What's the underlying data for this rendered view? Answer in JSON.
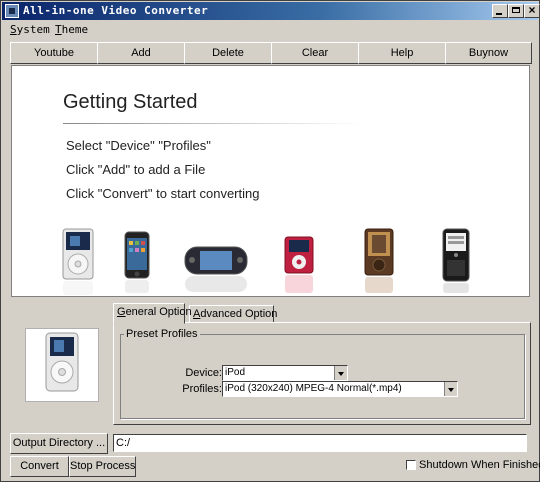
{
  "window": {
    "title": "All-in-one Video Converter"
  },
  "menu": [
    "System",
    "Theme"
  ],
  "toolbar": [
    "Youtube",
    "Add",
    "Delete",
    "Clear",
    "Help",
    "Buynow"
  ],
  "getting_started": {
    "title": "Getting Started",
    "lines": [
      "Select \"Device\" \"Profiles\"",
      "Click  \"Add\" to add a File",
      "Click  \"Convert\" to start converting"
    ]
  },
  "devices": [
    "ipod-classic",
    "iphone",
    "psp",
    "ipod-nano",
    "zune",
    "blackberry"
  ],
  "tabs": {
    "general": "General Option",
    "advanced": "Advanced Option"
  },
  "preset": {
    "group_label": "Preset Profiles",
    "device_label": "Device:",
    "device_value": "iPod",
    "profiles_label": "Profiles:",
    "profiles_value": "iPod (320x240) MPEG-4 Normal(*.mp4)"
  },
  "output": {
    "button": "Output Directory ...",
    "path": "C:/"
  },
  "actions": {
    "convert": "Convert",
    "stop": "Stop Process"
  },
  "shutdown": {
    "label": "Shutdown When Finished",
    "checked": false
  }
}
